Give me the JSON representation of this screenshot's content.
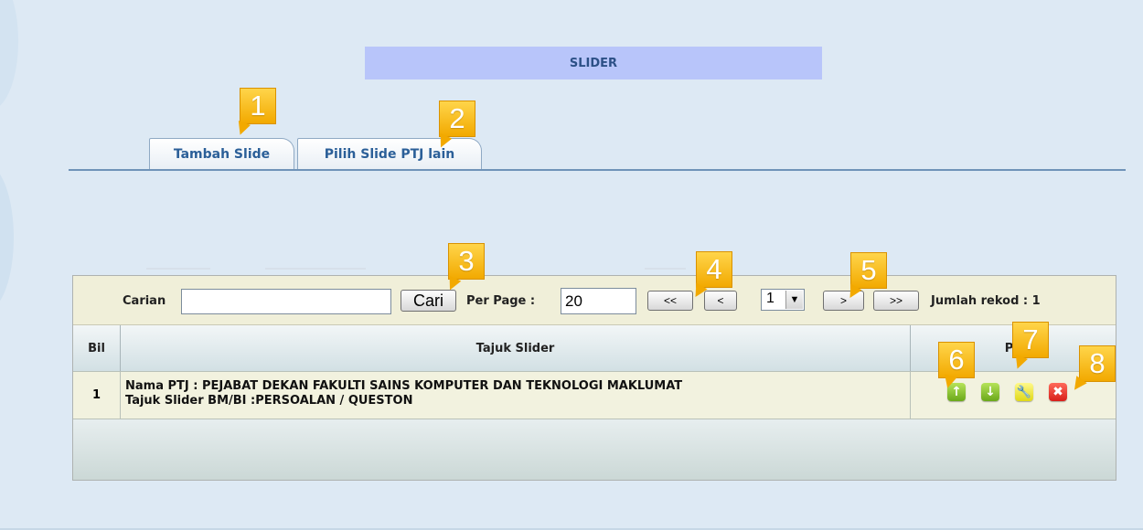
{
  "page": {
    "title": "SLIDER"
  },
  "tabs": [
    {
      "label": "Tambah Slide"
    },
    {
      "label": "Pilih Slide PTJ lain"
    }
  ],
  "toolbar": {
    "search_label": "Carian",
    "search_value": "",
    "search_button": "Cari",
    "per_page_label": "Per Page :",
    "per_page_value": "20",
    "first_button": "<<",
    "prev_button": "<",
    "page_select_value": "1",
    "next_button": ">",
    "last_button": ">>",
    "record_count_text": "Jumlah rekod : 1"
  },
  "table": {
    "headers": [
      "Bil",
      "Tajuk Slider",
      "Pil"
    ],
    "rows": [
      {
        "bil": "1",
        "line1": "Nama PTJ : PEJABAT DEKAN FAKULTI SAINS KOMPUTER DAN TEKNOLOGI MAKLUMAT",
        "line2": "Tajuk Slider BM/BI :PERSOALAN / QUESTON",
        "actions": [
          {
            "icon": "arrow-up-icon",
            "glyph": "↑",
            "color": "#7dbb26"
          },
          {
            "icon": "arrow-down-icon",
            "glyph": "↓",
            "color": "#7dbb26"
          },
          {
            "icon": "wrench-icon",
            "glyph": "🔧",
            "color": "#ece31f"
          },
          {
            "icon": "delete-icon",
            "glyph": "✖",
            "color": "#e22b22"
          }
        ]
      }
    ]
  },
  "callouts": [
    "1",
    "2",
    "3",
    "4",
    "5",
    "6",
    "7",
    "8"
  ],
  "colors": {
    "title_bar": "#b8c5fa",
    "tab_text": "#2b5f98",
    "callout": "#f5b400",
    "toolbar_bg": "#f0efd9"
  }
}
